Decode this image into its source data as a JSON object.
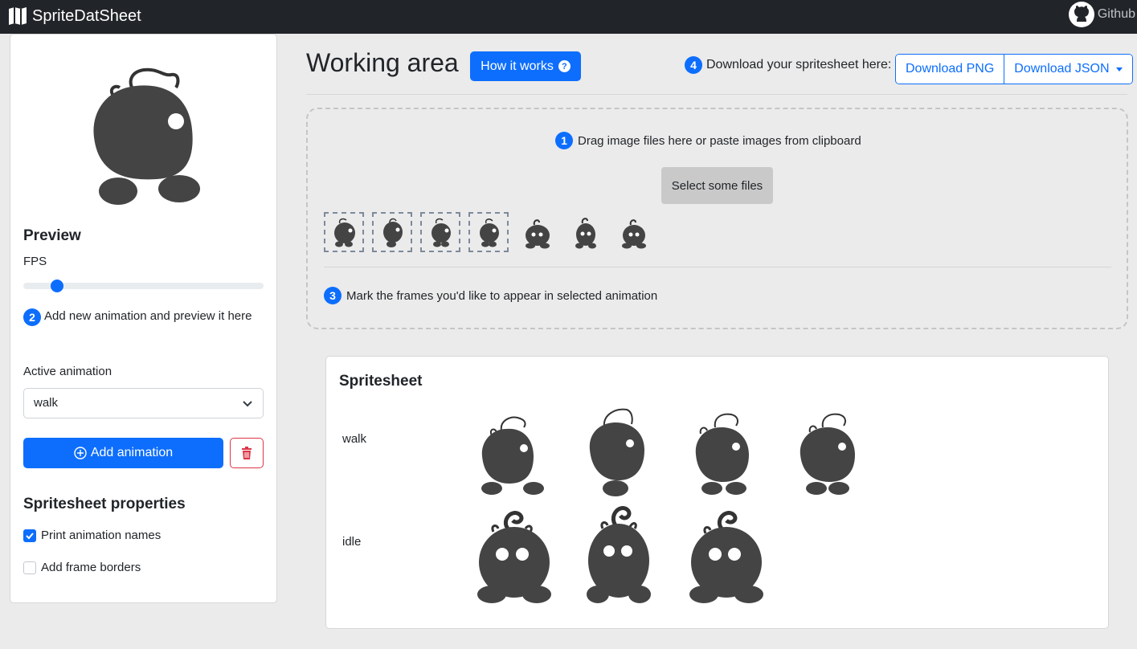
{
  "navbar": {
    "brand": "SpriteDatSheet",
    "github": "Github"
  },
  "sidebar": {
    "preview_title": "Preview",
    "fps_label": "FPS",
    "fps_value": 0.12,
    "step2_number": "2",
    "step2_text": "Add new animation and preview it here",
    "active_animation_label": "Active animation",
    "active_animation_value": "walk",
    "add_animation_label": "Add animation",
    "props_title": "Spritesheet properties",
    "print_names_label": "Print animation names",
    "print_names_checked": true,
    "frame_borders_label": "Add frame borders",
    "frame_borders_checked": false
  },
  "main": {
    "title": "Working area",
    "how_label": "How it works",
    "how_icon": "?",
    "step4_number": "4",
    "download_label": "Download your spritesheet here:",
    "download_png": "Download PNG",
    "download_json": "Download JSON"
  },
  "dropzone": {
    "step1_number": "1",
    "step1_text": "Drag image files here or paste images from clipboard",
    "select_files": "Select some files",
    "step3_number": "3",
    "step3_text": "Mark the frames you'd like to appear in selected animation"
  },
  "spritesheet": {
    "title": "Spritesheet",
    "rows": [
      "walk",
      "idle"
    ]
  },
  "colors": {
    "accent": "#0d6efd",
    "danger": "#dc3545",
    "navbar": "#212529",
    "sprite": "#444444"
  }
}
